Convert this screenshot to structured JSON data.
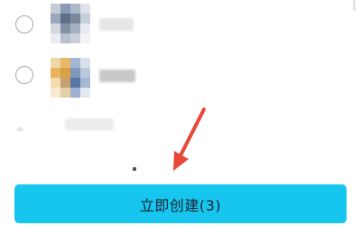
{
  "create_button": {
    "label": "立即创建(3)"
  },
  "colors": {
    "button_bg": "#16c6ef",
    "button_text": "#1c2330",
    "arrow": "#e8473a"
  },
  "contacts": [
    {
      "selected": false,
      "avatar": "blurred-avatar",
      "name": ""
    },
    {
      "selected": false,
      "avatar": "blurred-avatar",
      "name": ""
    }
  ],
  "icons": {
    "radio": "radio-unchecked-icon",
    "arrow": "red-arrow-annotation"
  }
}
